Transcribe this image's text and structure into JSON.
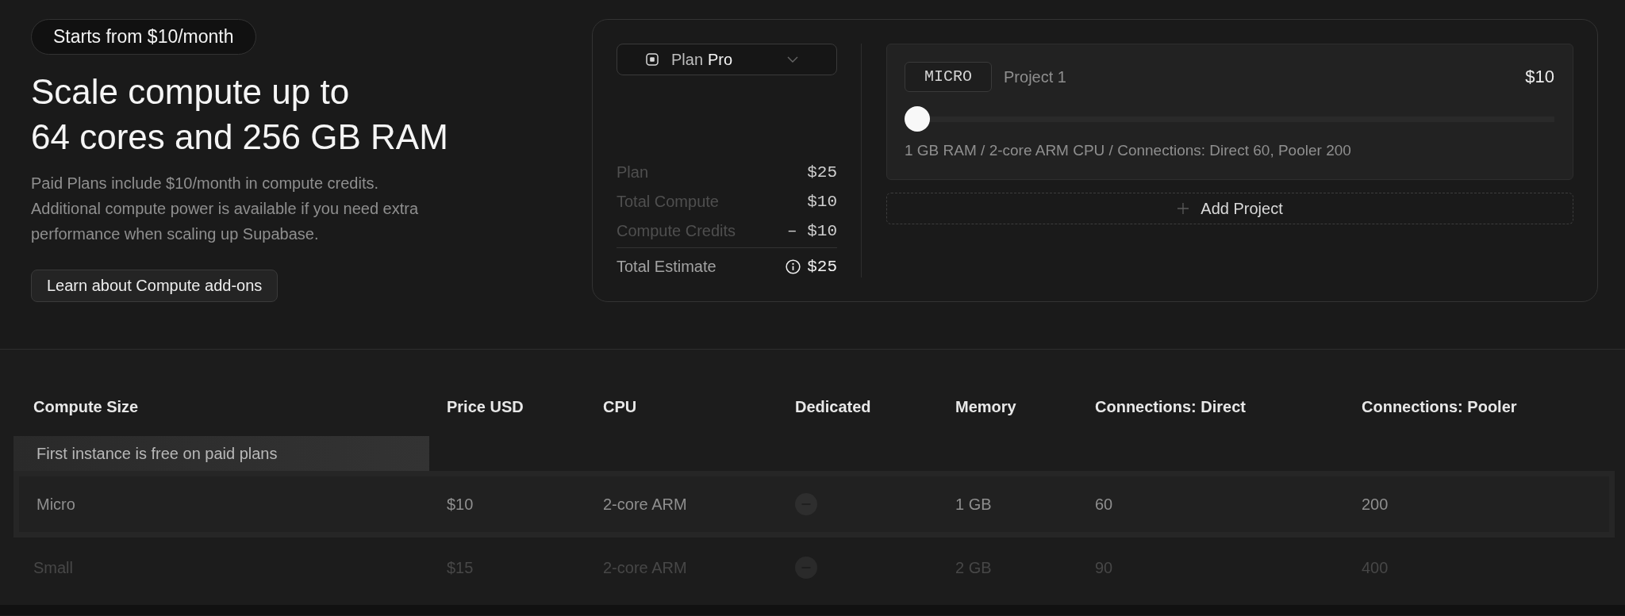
{
  "hero": {
    "badge": "Starts from $10/month",
    "title_lines": [
      "Scale compute up to",
      "64 cores and 256 GB RAM"
    ],
    "description_lines": [
      "Paid Plans include $10/month in compute credits.",
      "Additional compute power is available if you need extra",
      "performance when scaling up Supabase."
    ],
    "button": "Learn about Compute add-ons"
  },
  "calculator": {
    "plan_select": {
      "label": "Plan",
      "value": "Pro"
    },
    "summary": [
      {
        "label": "Plan",
        "value": "$25"
      },
      {
        "label": "Total Compute",
        "value": "$10"
      },
      {
        "label": "Compute Credits",
        "value": "– $10"
      }
    ],
    "total": {
      "label": "Total Estimate",
      "value": "$25"
    },
    "projects": [
      {
        "size": "MICRO",
        "name": "Project 1",
        "price": "$10",
        "level": 0,
        "specs": "1 GB RAM / 2-core ARM CPU / Connections: Direct 60, Pooler 200"
      }
    ],
    "add_button": "Add Project"
  },
  "table": {
    "columns": [
      "Compute Size",
      "Price USD",
      "CPU",
      "Dedicated",
      "Memory",
      "Connections: Direct",
      "Connections: Pooler"
    ],
    "note": "First instance is free on paid plans",
    "rows": [
      {
        "compute_size": "Micro",
        "price": "$10",
        "cpu": "2-core ARM",
        "dedicated": false,
        "memory": "1 GB",
        "connections_direct": "60",
        "connections_pooler": "200",
        "highlighted": true
      },
      {
        "compute_size": "Small",
        "price": "$15",
        "cpu": "2-core ARM",
        "dedicated": false,
        "memory": "2 GB",
        "connections_direct": "90",
        "connections_pooler": "400",
        "highlighted": false
      }
    ]
  }
}
